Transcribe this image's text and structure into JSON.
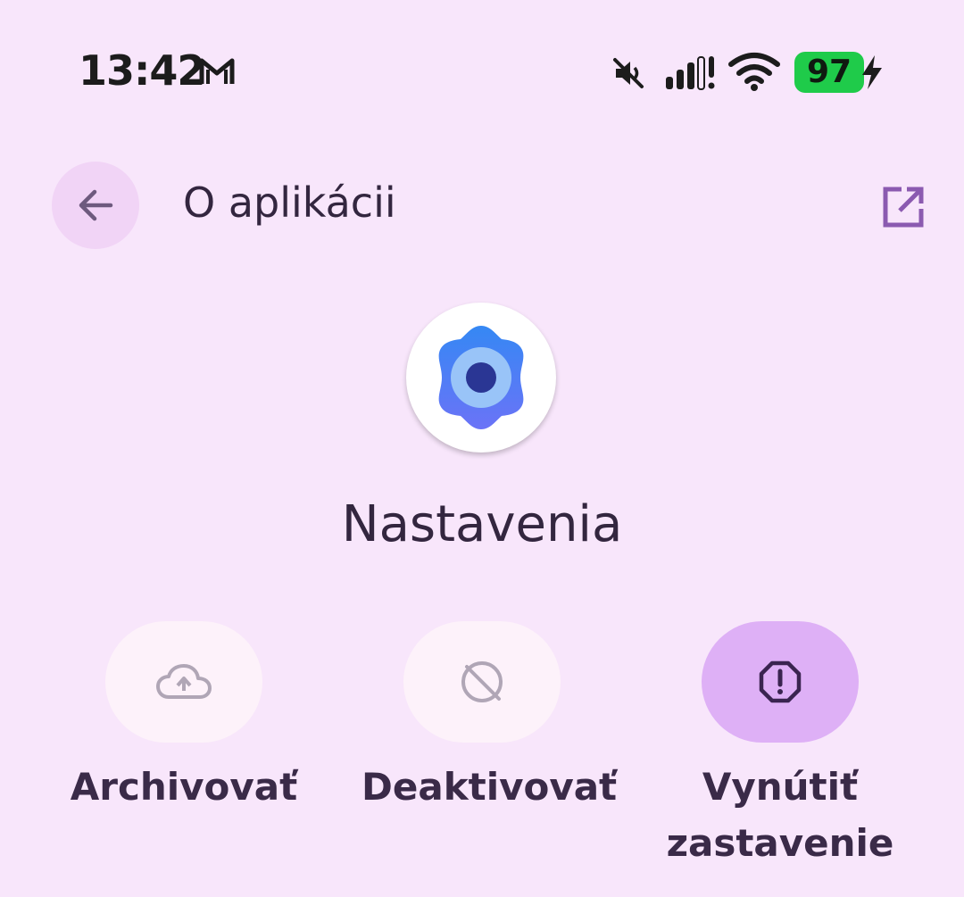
{
  "status_bar": {
    "time": "13:42",
    "battery": "97",
    "icons": [
      "gmail-icon",
      "mute-icon",
      "signal-icon",
      "wifi-icon",
      "battery-icon",
      "charging-bolt-icon"
    ]
  },
  "header": {
    "title": "O aplikácii",
    "back_icon": "arrow-left-icon",
    "open_icon": "open-external-icon"
  },
  "app": {
    "name": "Nastavenia",
    "icon": "settings-gear-icon"
  },
  "actions": [
    {
      "label": "Archivovať",
      "icon": "cloud-upload-icon",
      "enabled": false
    },
    {
      "label": "Deaktivovať",
      "icon": "disable-icon",
      "enabled": false
    },
    {
      "label_line1": "Vynútiť",
      "label_line2": "zastavenie",
      "icon": "warning-octagon-icon",
      "enabled": true
    }
  ],
  "colors": {
    "background": "#f8e6fb",
    "accent": "#deb0f6",
    "battery": "#1fcb4a",
    "text": "#3a2a48"
  }
}
